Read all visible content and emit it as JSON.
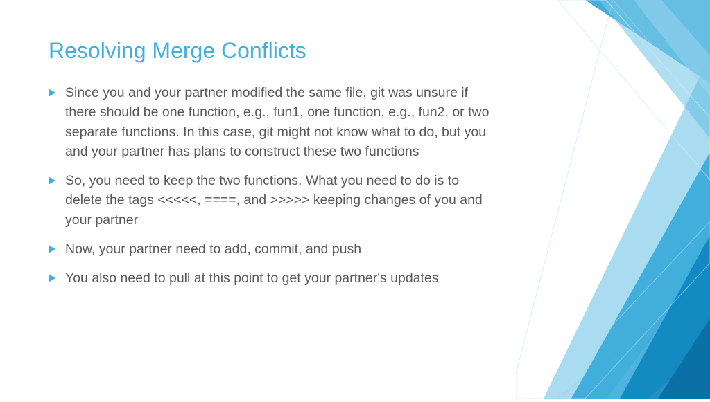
{
  "slide": {
    "title": "Resolving Merge Conflicts",
    "bullets": [
      "Since you and your partner modified the same file, git was unsure if there should be one function, e.g., fun1, one function, e.g., fun2, or two separate functions. In this case, git might not know what to do, but you and your partner has plans to construct these two functions",
      "So, you need to keep the two functions. What you need to do is to delete the tags <<<<<, ====, and >>>>> keeping changes of you and your partner",
      "Now, your partner need to add, commit, and push",
      "You also need to pull at this point to get your partner's updates"
    ]
  }
}
